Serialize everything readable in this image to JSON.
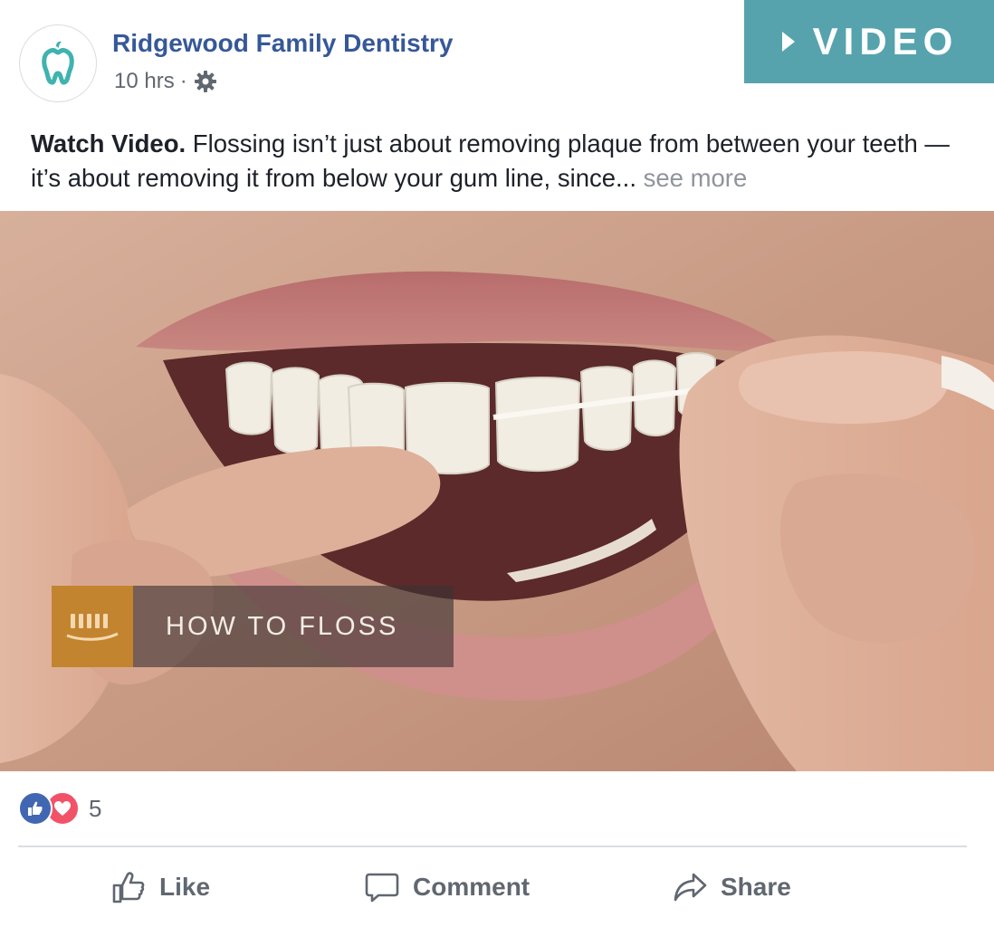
{
  "post": {
    "page_name": "Ridgewood Family Dentistry",
    "time": "10 hrs",
    "separator": "·",
    "badge": "VIDEO",
    "caption_bold": "Watch Video.",
    "caption_text": " Flossing isn’t just about removing plaque from between your teeth — it’s about removing it from below your gum line, since...",
    "see_more": "see more"
  },
  "media": {
    "overlay_title": "HOW TO FLOSS"
  },
  "reactions": {
    "count": "5",
    "types": [
      "like-icon",
      "love-icon"
    ]
  },
  "actions": {
    "like": "Like",
    "comment": "Comment",
    "share": "Share"
  },
  "colors": {
    "link_blue": "#365899",
    "badge_teal": "#56a3ad",
    "overlay_orange": "#c3842f",
    "like_blue": "#4267b2",
    "love_red": "#f25268"
  }
}
